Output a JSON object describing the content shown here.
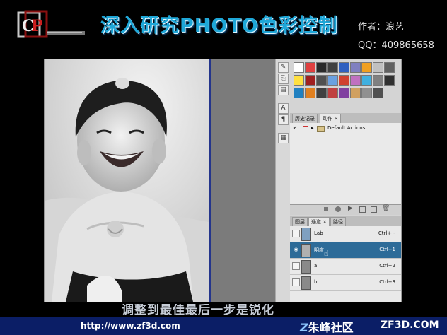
{
  "header": {
    "title": "深入研究PHOTO色彩控制",
    "author": "作者：浪艺",
    "qq": "QQ：409865658"
  },
  "panels": {
    "tabs_top": [
      {
        "label": "历史记录",
        "active": false
      },
      {
        "label": "动作 ×",
        "active": true
      }
    ],
    "action_set": "Default Actions",
    "tabs_bottom": [
      {
        "label": "图层",
        "active": false
      },
      {
        "label": "通道 ×",
        "active": true
      },
      {
        "label": "路径",
        "active": false
      }
    ],
    "channels": [
      {
        "name": "Lab",
        "shortcut": "Ctrl+~",
        "selected": false,
        "visible": false
      },
      {
        "name": "明度",
        "shortcut": "Ctrl+1",
        "selected": true,
        "visible": true
      },
      {
        "name": "a",
        "shortcut": "Ctrl+2",
        "selected": false,
        "visible": false
      },
      {
        "name": "b",
        "shortcut": "Ctrl+3",
        "selected": false,
        "visible": false
      }
    ],
    "swatch_colors": [
      "#ffffff",
      "#e04040",
      "#2a2a2a",
      "#404040",
      "#3060c0",
      "#8080c0",
      "#f0a020",
      "#c0c0c0",
      "#606060",
      "#ffe040",
      "#a02020",
      "#505050",
      "#6aa0e0",
      "#d04030",
      "#c070c0",
      "#40b0e0",
      "#808080",
      "#303030",
      "#2080c0",
      "#e08020",
      "#404040",
      "#c04040",
      "#8040a0",
      "#d0a060",
      "#909090",
      "#505050"
    ]
  },
  "caption": "调整到最佳最后一步是锐化",
  "footer": {
    "url": "http://www.zf3d.com",
    "community": "朱峰社区",
    "domain": "ZF3D.COM"
  }
}
